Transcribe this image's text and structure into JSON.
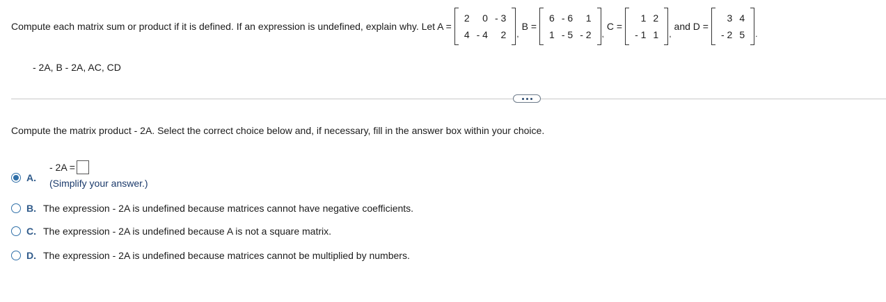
{
  "problem": {
    "intro": "Compute each matrix sum or product if it is defined. If an expression is undefined, explain why. Let A =",
    "matrices": {
      "A": [
        [
          "2",
          "0",
          "- 3"
        ],
        [
          "4",
          "- 4",
          "2"
        ]
      ],
      "B": [
        [
          "6",
          "- 6",
          "1"
        ],
        [
          "1",
          "- 5",
          "- 2"
        ]
      ],
      "C": [
        [
          "1",
          "2"
        ],
        [
          "- 1",
          "1"
        ]
      ],
      "D": [
        [
          "3",
          "4"
        ],
        [
          "- 2",
          "5"
        ]
      ]
    },
    "b_label": "B =",
    "c_label": "C =",
    "and_d_label": "and D =",
    "comma": ",",
    "period": ".",
    "expressions": "- 2A, B - 2A, AC, CD"
  },
  "question": {
    "text": "Compute the matrix product  - 2A. Select the correct choice below and, if necessary, fill in the answer box within your choice."
  },
  "choices": {
    "a": {
      "letter": "A.",
      "prefix": "- 2A =",
      "hint": "(Simplify your answer.)",
      "selected": true
    },
    "b": {
      "letter": "B.",
      "text": "The expression  - 2A is undefined because matrices cannot have negative coefficients."
    },
    "c": {
      "letter": "C.",
      "text": "The expression  - 2A is undefined because A is not a square matrix."
    },
    "d": {
      "letter": "D.",
      "text": "The expression  - 2A is undefined because matrices cannot be multiplied by numbers."
    }
  }
}
